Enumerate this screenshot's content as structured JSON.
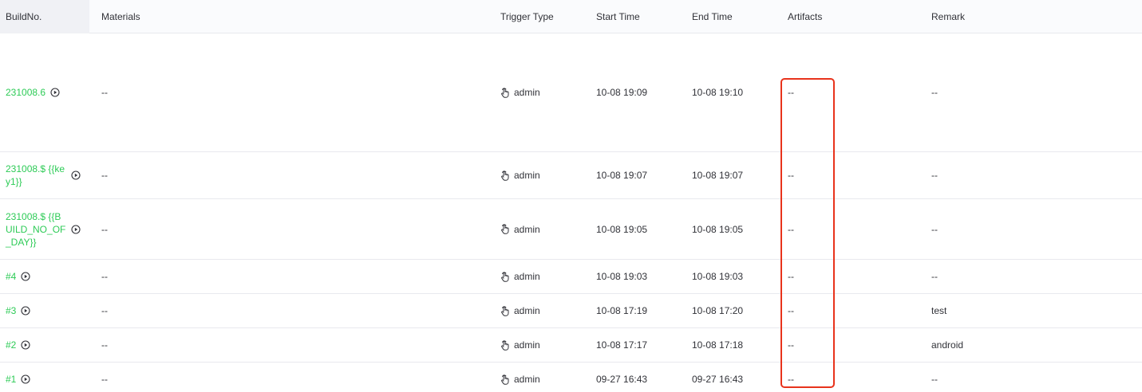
{
  "headers": {
    "build_no": "BuildNo.",
    "materials": "Materials",
    "trigger_type": "Trigger Type",
    "start_time": "Start Time",
    "end_time": "End Time",
    "artifacts": "Artifacts",
    "remark": "Remark"
  },
  "rows": [
    {
      "build": "231008.6",
      "materials": "--",
      "trigger": "admin",
      "start": "10-08 19:09",
      "end": "10-08 19:10",
      "artifacts": "--",
      "remark": "--"
    },
    {
      "build": "231008.$ {{key1}}",
      "materials": "--",
      "trigger": "admin",
      "start": "10-08 19:07",
      "end": "10-08 19:07",
      "artifacts": "--",
      "remark": "--"
    },
    {
      "build": "231008.$ {{BUILD_NO_OF_DAY}}",
      "materials": "--",
      "trigger": "admin",
      "start": "10-08 19:05",
      "end": "10-08 19:05",
      "artifacts": "--",
      "remark": "--"
    },
    {
      "build": "#4",
      "materials": "--",
      "trigger": "admin",
      "start": "10-08 19:03",
      "end": "10-08 19:03",
      "artifacts": "--",
      "remark": "--"
    },
    {
      "build": "#3",
      "materials": "--",
      "trigger": "admin",
      "start": "10-08 17:19",
      "end": "10-08 17:20",
      "artifacts": "--",
      "remark": "test"
    },
    {
      "build": "#2",
      "materials": "--",
      "trigger": "admin",
      "start": "10-08 17:17",
      "end": "10-08 17:18",
      "artifacts": "--",
      "remark": "android"
    },
    {
      "build": "#1",
      "materials": "--",
      "trigger": "admin",
      "start": "09-27 16:43",
      "end": "09-27 16:43",
      "artifacts": "--",
      "remark": "--"
    }
  ],
  "icons": {
    "build_action": "play-circle-icon",
    "trigger": "manual-trigger-hand-icon"
  },
  "colors": {
    "build_link": "#2dcb56",
    "highlight_box": "#e8331c"
  }
}
